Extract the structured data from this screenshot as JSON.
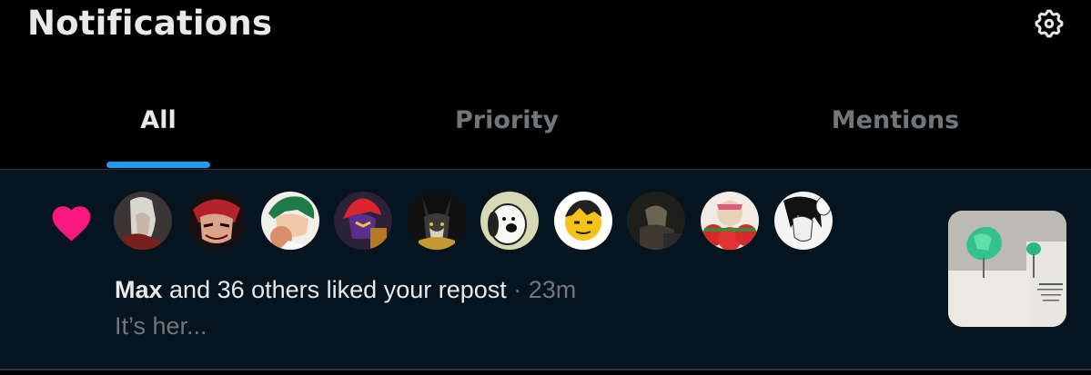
{
  "header": {
    "title": "Notifications",
    "settings_icon": "gear-icon"
  },
  "tabs": [
    {
      "label": "All",
      "active": true
    },
    {
      "label": "Priority",
      "active": false
    },
    {
      "label": "Mentions",
      "active": false
    }
  ],
  "notification": {
    "icon": "heart-icon",
    "icon_color": "#f91880",
    "avatars": [
      {
        "name": "avatar-1"
      },
      {
        "name": "avatar-2"
      },
      {
        "name": "avatar-3"
      },
      {
        "name": "avatar-4"
      },
      {
        "name": "avatar-5"
      },
      {
        "name": "avatar-6"
      },
      {
        "name": "avatar-7"
      },
      {
        "name": "avatar-8"
      },
      {
        "name": "avatar-9"
      },
      {
        "name": "avatar-10"
      }
    ],
    "actor": "Max",
    "action_text": " and 36 others liked your repost",
    "separator": " · ",
    "time": "23m",
    "preview": "It’s her..."
  },
  "colors": {
    "background": "#000000",
    "highlight_background": "#061420",
    "accent": "#1d9bf0",
    "text_primary": "#e7e9ea",
    "text_secondary": "#71767b"
  }
}
